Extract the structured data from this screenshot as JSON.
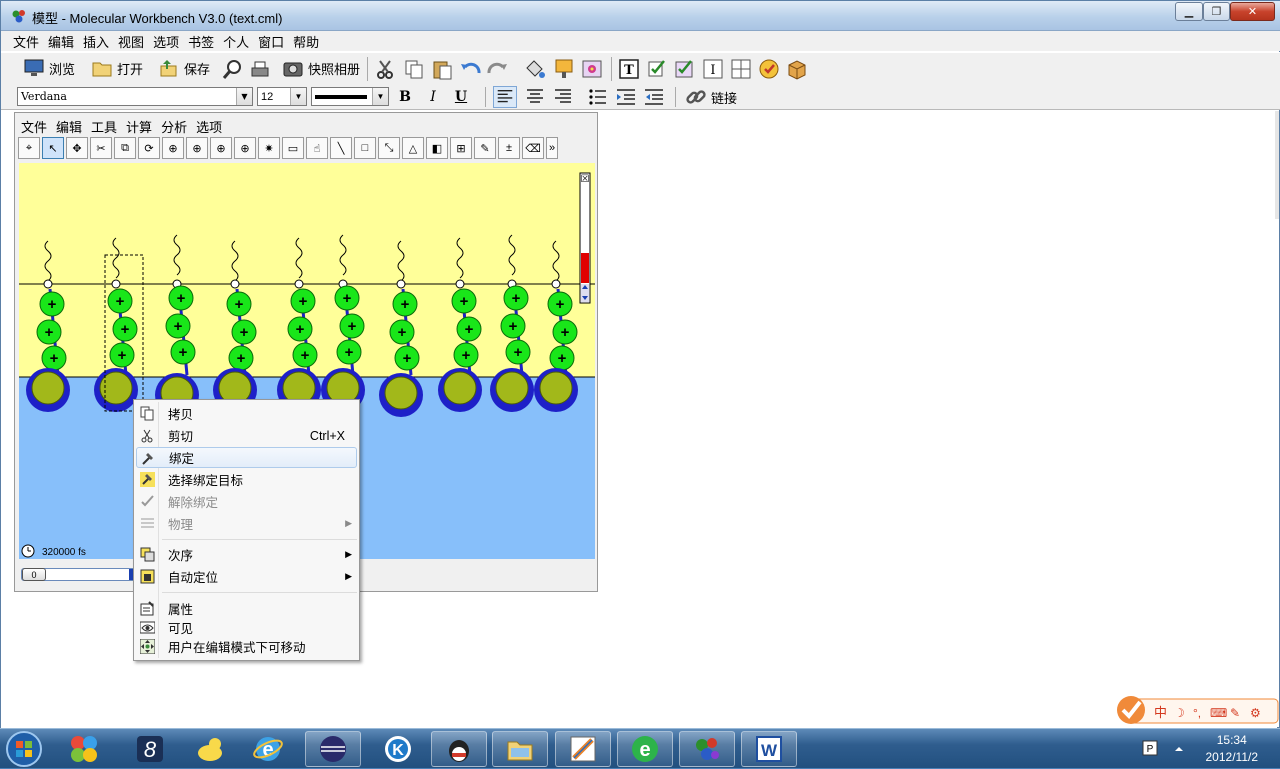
{
  "window": {
    "title": "模型 - Molecular Workbench V3.0 (text.cml)"
  },
  "menubar": [
    "文件",
    "编辑",
    "插入",
    "视图",
    "选项",
    "书签",
    "个人",
    "窗口",
    "帮助"
  ],
  "toolbar": {
    "browse": "浏览",
    "open": "打开",
    "save": "保存",
    "snapshot": "快照相册"
  },
  "format": {
    "font": "Verdana",
    "size": "12",
    "bold": "B",
    "italic": "I",
    "underline": "U",
    "link": "链接"
  },
  "inner_menu": [
    "文件",
    "编辑",
    "工具",
    "计算",
    "分析",
    "选项"
  ],
  "sim": {
    "time": "320000 fs",
    "slider_value": "0"
  },
  "context_menu": {
    "copy": "拷贝",
    "cut": "剪切",
    "cut_shortcut": "Ctrl+X",
    "bind": "绑定",
    "choose_target": "选择绑定目标",
    "unbind": "解除绑定",
    "physics": "物理",
    "order": "次序",
    "auto_position": "自动定位",
    "properties": "属性",
    "visible": "可见",
    "movable": "用户在编辑模式下可移动"
  },
  "taskbar": {
    "time": "15:34",
    "date": "2012/11/2"
  },
  "colors": {
    "sky": "#ffff99",
    "water": "#87bffa",
    "ring": "#1e20c8",
    "core": "#a2b81a",
    "bead": "#19e619"
  }
}
